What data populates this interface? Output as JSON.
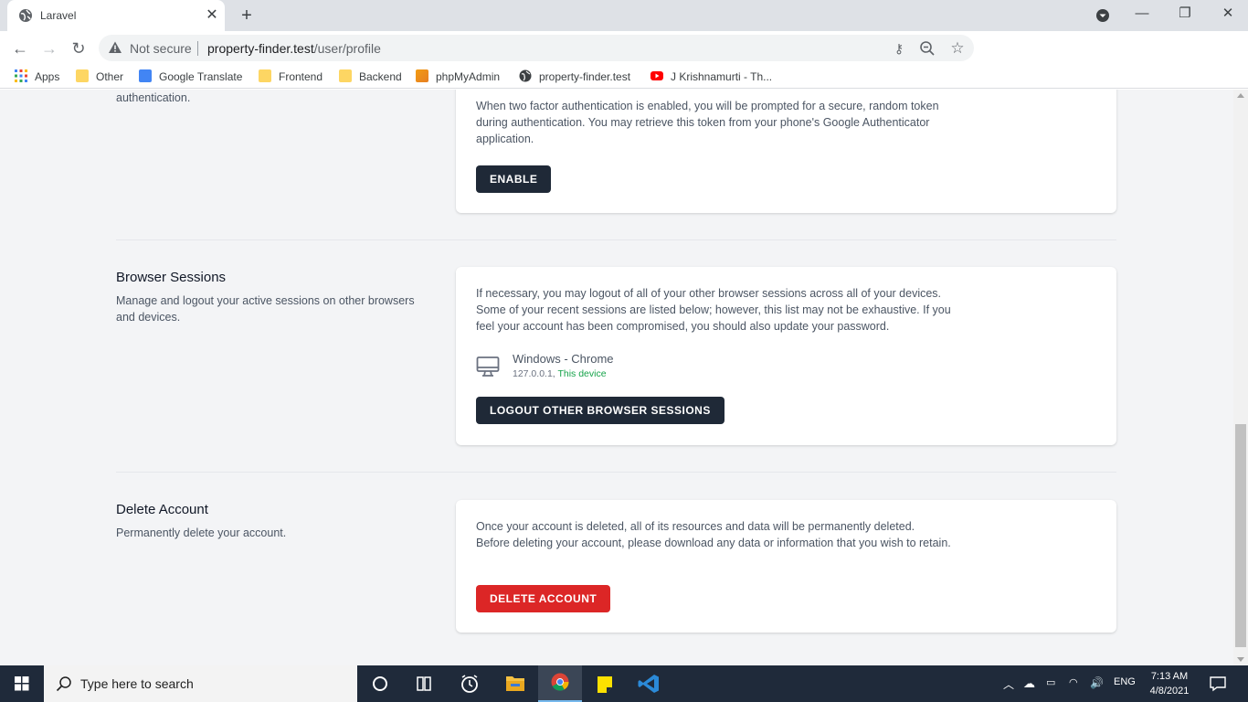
{
  "browser": {
    "tab_title": "Laravel",
    "omnibox": {
      "security_label": "Not secure",
      "url_host": "property-finder.test",
      "url_path": "/user/profile"
    },
    "bookmarks": [
      {
        "label": "Apps",
        "icon": "apps-grid-icon"
      },
      {
        "label": "Other",
        "icon": "folder-icon"
      },
      {
        "label": "Google Translate",
        "icon": "google-translate-icon"
      },
      {
        "label": "Frontend",
        "icon": "folder-icon"
      },
      {
        "label": "Backend",
        "icon": "folder-icon"
      },
      {
        "label": "phpMyAdmin",
        "icon": "phpmyadmin-icon"
      },
      {
        "label": "property-finder.test",
        "icon": "globe-icon"
      },
      {
        "label": "J Krishnamurti - Th...",
        "icon": "youtube-icon"
      }
    ]
  },
  "page": {
    "two_factor": {
      "desc_tail": "authentication.",
      "body": "When two factor authentication is enabled, you will be prompted for a secure, random token during authentication. You may retrieve this token from your phone's Google Authenticator application.",
      "button": "Enable"
    },
    "browser_sessions": {
      "title": "Browser Sessions",
      "desc": "Manage and logout your active sessions on other browsers and devices.",
      "body": "If necessary, you may logout of all of your other browser sessions across all of your devices. Some of your recent sessions are listed below; however, this list may not be exhaustive. If you feel your account has been compromised, you should also update your password.",
      "session": {
        "device": "Windows - Chrome",
        "ip": "127.0.0.1,",
        "current": "This device"
      },
      "button": "Logout Other Browser Sessions"
    },
    "delete_account": {
      "title": "Delete Account",
      "desc": "Permanently delete your account.",
      "body": "Once your account is deleted, all of its resources and data will be permanently deleted. Before deleting your account, please download any data or information that you wish to retain.",
      "button": "Delete Account"
    }
  },
  "taskbar": {
    "search_placeholder": "Type here to search",
    "language": "ENG",
    "time": "7:13 AM",
    "date": "4/8/2021"
  },
  "colors": {
    "dark_button": "#1f2937",
    "danger_button": "#dc2626",
    "this_device": "#16a34a",
    "page_bg": "#f3f4f6"
  }
}
